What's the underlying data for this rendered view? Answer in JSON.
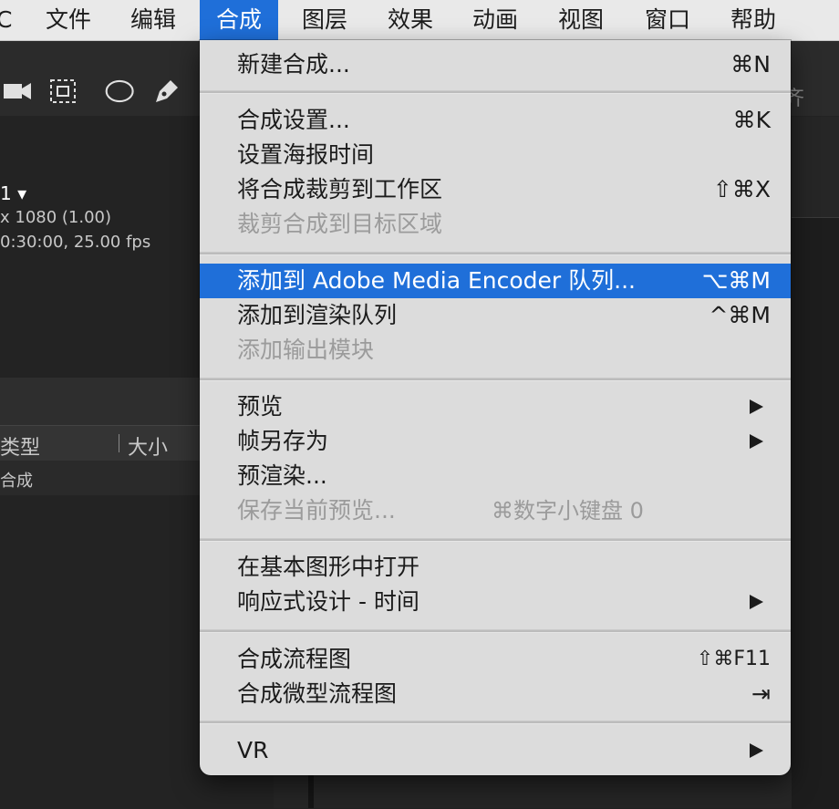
{
  "menubar": {
    "items": [
      {
        "label": "C"
      },
      {
        "label": "文件"
      },
      {
        "label": "编辑"
      },
      {
        "label": "合成"
      },
      {
        "label": "图层"
      },
      {
        "label": "效果"
      },
      {
        "label": "动画"
      },
      {
        "label": "视图"
      },
      {
        "label": "窗口"
      },
      {
        "label": "帮助"
      }
    ],
    "active_index": 3
  },
  "background": {
    "align_label": "齐",
    "comp_name": "1 ▾",
    "comp_size": "x 1080 (1.00)",
    "comp_duration": "0:30:00, 25.00 fps",
    "columns": {
      "type": "类型",
      "size": "大小"
    },
    "row_type": "合成"
  },
  "menu": {
    "new_comp": {
      "label": "新建合成...",
      "shortcut": "⌘N"
    },
    "comp_settings": {
      "label": "合成设置...",
      "shortcut": "⌘K"
    },
    "set_poster": {
      "label": "设置海报时间"
    },
    "trim_comp": {
      "label": "将合成裁剪到工作区",
      "shortcut": "⇧⌘X"
    },
    "crop_comp": {
      "label": "裁剪合成到目标区域"
    },
    "add_ame": {
      "label": "添加到 Adobe Media Encoder 队列...",
      "shortcut": "⌥⌘M"
    },
    "add_render": {
      "label": "添加到渲染队列",
      "shortcut": "^⌘M"
    },
    "add_output": {
      "label": "添加输出模块"
    },
    "preview": {
      "label": "预览"
    },
    "save_frame": {
      "label": "帧另存为"
    },
    "pre_render": {
      "label": "预渲染..."
    },
    "save_preview": {
      "label": "保存当前预览...",
      "shortcut": "⌘数字小键盘 0"
    },
    "open_essential": {
      "label": "在基本图形中打开"
    },
    "responsive": {
      "label": "响应式设计 - 时间"
    },
    "flowchart": {
      "label": "合成流程图",
      "shortcut": "⇧⌘F11"
    },
    "mini_flowchart": {
      "label": "合成微型流程图",
      "shortcut": "⇥"
    },
    "vr": {
      "label": "VR"
    }
  },
  "colors": {
    "highlight": "#1f6fd9",
    "menu_bg": "#dcdcdc",
    "disabled_text": "#9b9b9b"
  }
}
